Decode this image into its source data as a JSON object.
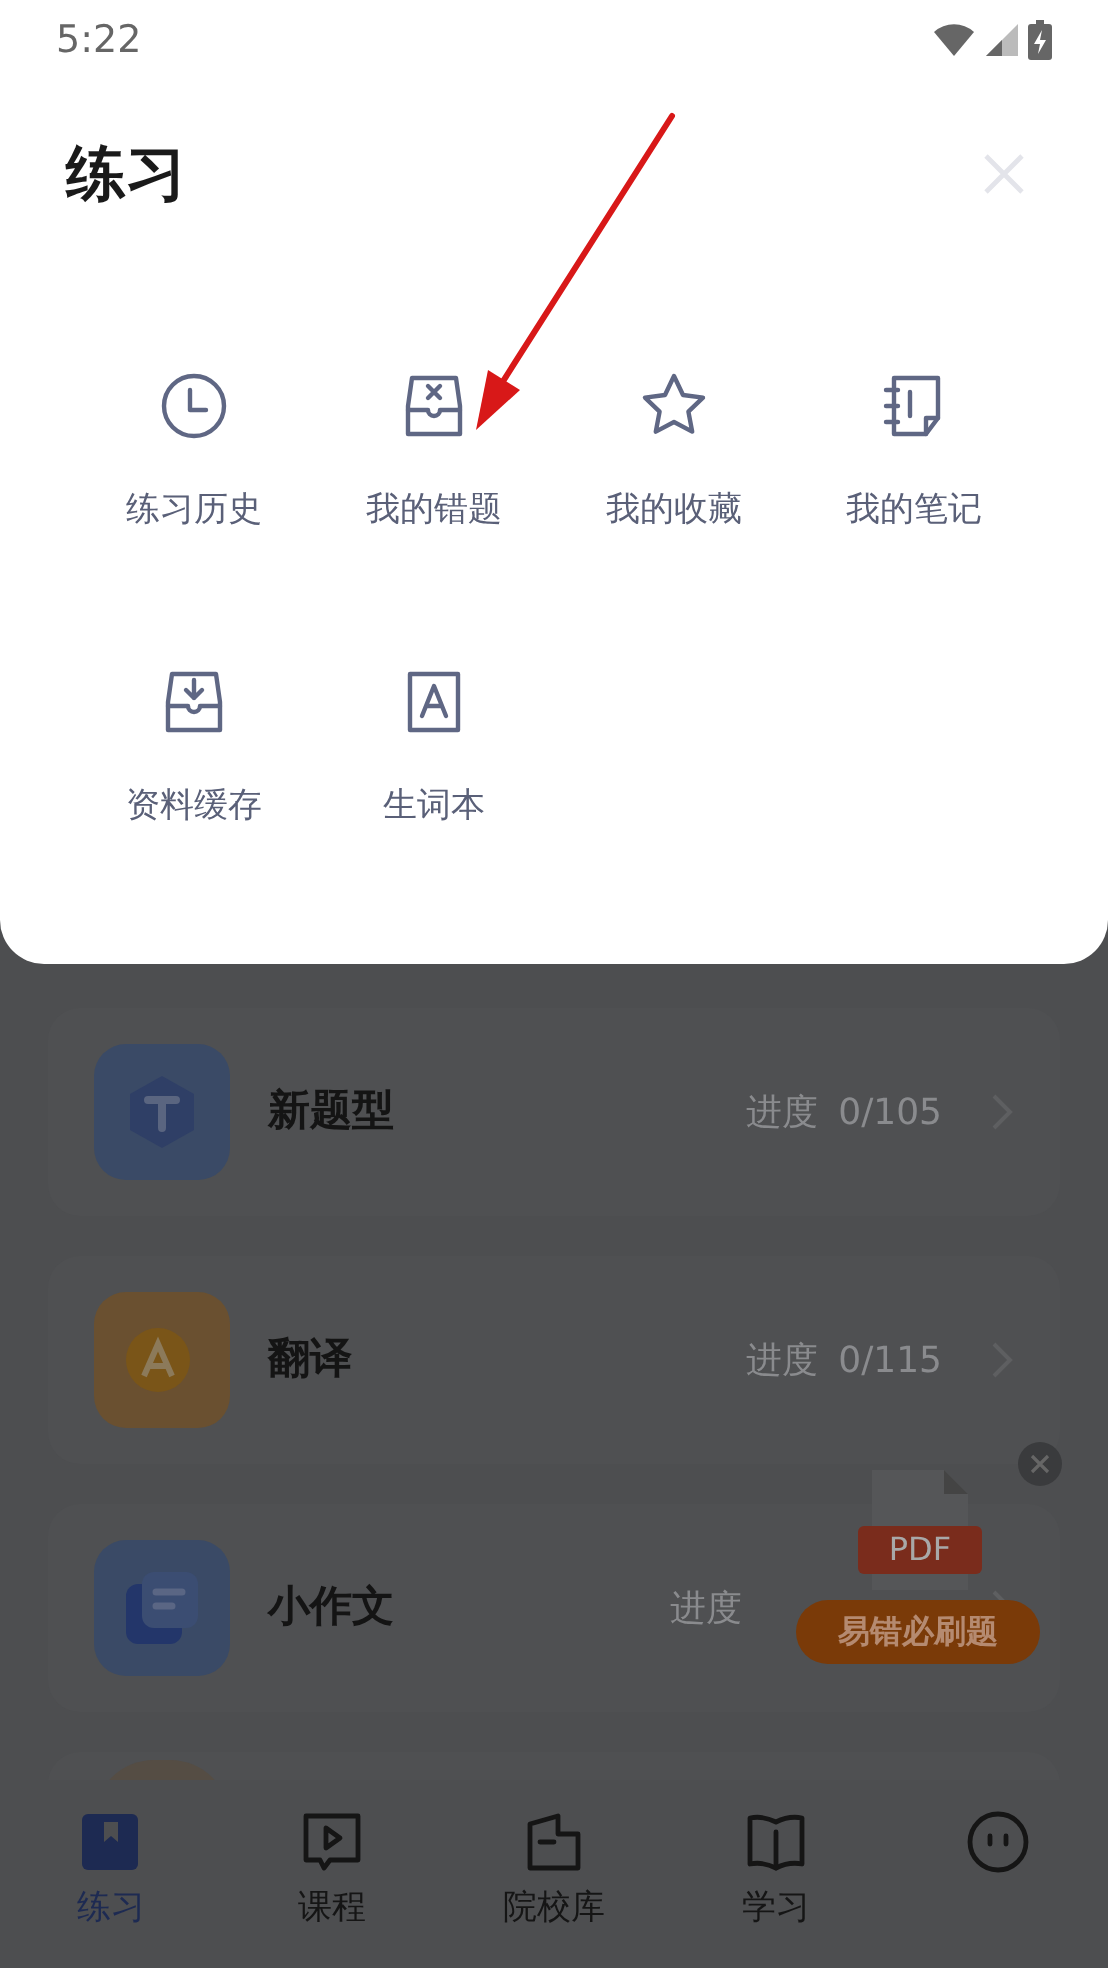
{
  "status_bar": {
    "time": "5:22"
  },
  "sheet": {
    "title": "练习",
    "items": [
      {
        "label": "练习历史",
        "kind": "clock"
      },
      {
        "label": "我的错题",
        "kind": "tray-x"
      },
      {
        "label": "我的收藏",
        "kind": "star"
      },
      {
        "label": "我的笔记",
        "kind": "notebook"
      },
      {
        "label": "资料缓存",
        "kind": "tray-down"
      },
      {
        "label": "生词本",
        "kind": "letter-a"
      }
    ]
  },
  "courses": [
    {
      "title": "新题型",
      "progress_label": "进度",
      "progress": "0/105",
      "kind": "hexagon",
      "color": "#3a4a66"
    },
    {
      "title": "翻译",
      "progress_label": "进度",
      "progress": "0/115",
      "kind": "speech",
      "color": "#6a5030"
    },
    {
      "title": "小作文",
      "progress_label": "进度",
      "kind": "stack",
      "color": "#3a4a66"
    }
  ],
  "promo": {
    "badge": "PDF",
    "button": "易错必刷题"
  },
  "nav": [
    {
      "label": "练习",
      "selected": true,
      "kind": "bookmark"
    },
    {
      "label": "课程",
      "selected": false,
      "kind": "play"
    },
    {
      "label": "院校库",
      "selected": false,
      "kind": "folder"
    },
    {
      "label": "学习",
      "selected": false,
      "kind": "book"
    },
    {
      "selected": false,
      "kind": "face"
    }
  ]
}
